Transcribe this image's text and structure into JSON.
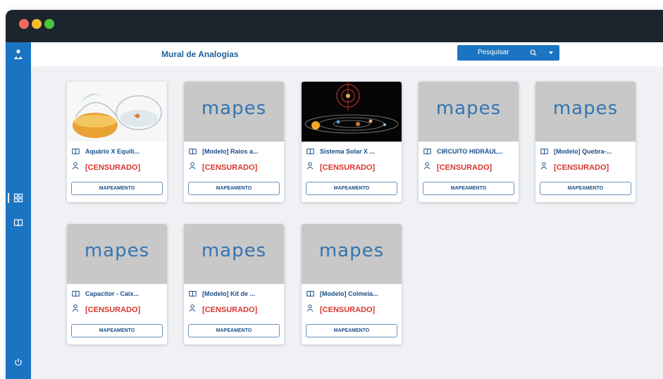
{
  "window": {
    "controls": [
      "close",
      "minimize",
      "maximize"
    ],
    "colors": {
      "titlebar": "#1c242e",
      "sidebar": "#1b74c2",
      "background": "#f0f1f4"
    }
  },
  "sidebar": {
    "items": [
      {
        "icon": "app-logo-icon"
      },
      {
        "icon": "grid-icon",
        "active": true
      },
      {
        "icon": "book-icon"
      },
      {
        "icon": "power-icon"
      }
    ]
  },
  "header": {
    "title": "Mural de Analogias",
    "search_label": "Pesquisar"
  },
  "cards": [
    {
      "title": "Aquário X Equilí...",
      "author": "[CENSURADO]",
      "button": "MAPEAMENTO",
      "thumb": "aquario"
    },
    {
      "title": "[Modelo] Raios a...",
      "author": "[CENSURADO]",
      "button": "MAPEAMENTO",
      "thumb": "logo",
      "logo_text": "mapes"
    },
    {
      "title": "Sistema Solar X ...",
      "author": "[CENSURADO]",
      "button": "MAPEAMENTO",
      "thumb": "solar"
    },
    {
      "title": "CIRCUITO HIDRÁUL...",
      "author": "[CENSURADO]",
      "button": "MAPEAMENTO",
      "thumb": "logo",
      "logo_text": "mapes"
    },
    {
      "title": "[Modelo] Quebra-...",
      "author": "[CENSURADO]",
      "button": "MAPEAMENTO",
      "thumb": "logo",
      "logo_text": "mapes"
    },
    {
      "title": "Capacitor - Caix...",
      "author": "[CENSURADO]",
      "button": "MAPEAMENTO",
      "thumb": "logo",
      "logo_text": "mapes"
    },
    {
      "title": "[Modelo] Kit de ...",
      "author": "[CENSURADO]",
      "button": "MAPEAMENTO",
      "thumb": "logo",
      "logo_text": "mapes"
    },
    {
      "title": "[Modelo] Colmeia...",
      "author": "[CENSURADO]",
      "button": "MAPEAMENTO",
      "thumb": "logo",
      "logo_text": "mapes"
    }
  ]
}
